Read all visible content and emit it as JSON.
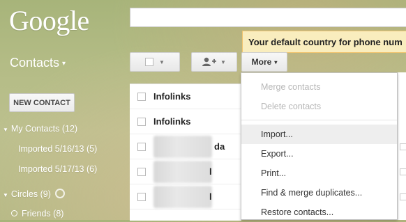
{
  "brand": {
    "logo": "Google"
  },
  "search": {
    "value": ""
  },
  "app": {
    "title": "Contacts",
    "caret": "▾"
  },
  "toolbar": {
    "select_caret": "▼",
    "add_caret": "▼",
    "more_label": "More",
    "more_caret": "▾"
  },
  "notice": {
    "text": "Your default country for phone num"
  },
  "sidebar": {
    "new_contact_label": "NEW CONTACT",
    "my_contacts_label": "My Contacts (12)",
    "imported_1": "Imported 5/16/13 (5)",
    "imported_2": "Imported 5/17/13 (6)",
    "circles_label": "Circles (9)",
    "friends_label": "Friends (8)"
  },
  "contacts_list": {
    "rows": [
      {
        "name": "Infolinks"
      },
      {
        "name": "Infolinks"
      },
      {
        "name": "",
        "suffix": "da"
      },
      {
        "name": "",
        "suffix": "l"
      },
      {
        "name": "",
        "suffix": "l"
      }
    ]
  },
  "more_menu": {
    "items": [
      {
        "label": "Merge contacts",
        "enabled": false
      },
      {
        "label": "Delete contacts",
        "enabled": false
      },
      {
        "label": "Import...",
        "enabled": true,
        "highlighted": true
      },
      {
        "label": "Export...",
        "enabled": true
      },
      {
        "label": "Print...",
        "enabled": true
      },
      {
        "label": "Find & merge duplicates...",
        "enabled": true
      },
      {
        "label": "Restore contacts...",
        "enabled": true
      }
    ]
  },
  "colors": {
    "notice_bg": "#f9edbe",
    "notice_border": "#f0c36d",
    "menu_highlight": "#eeeeee"
  }
}
